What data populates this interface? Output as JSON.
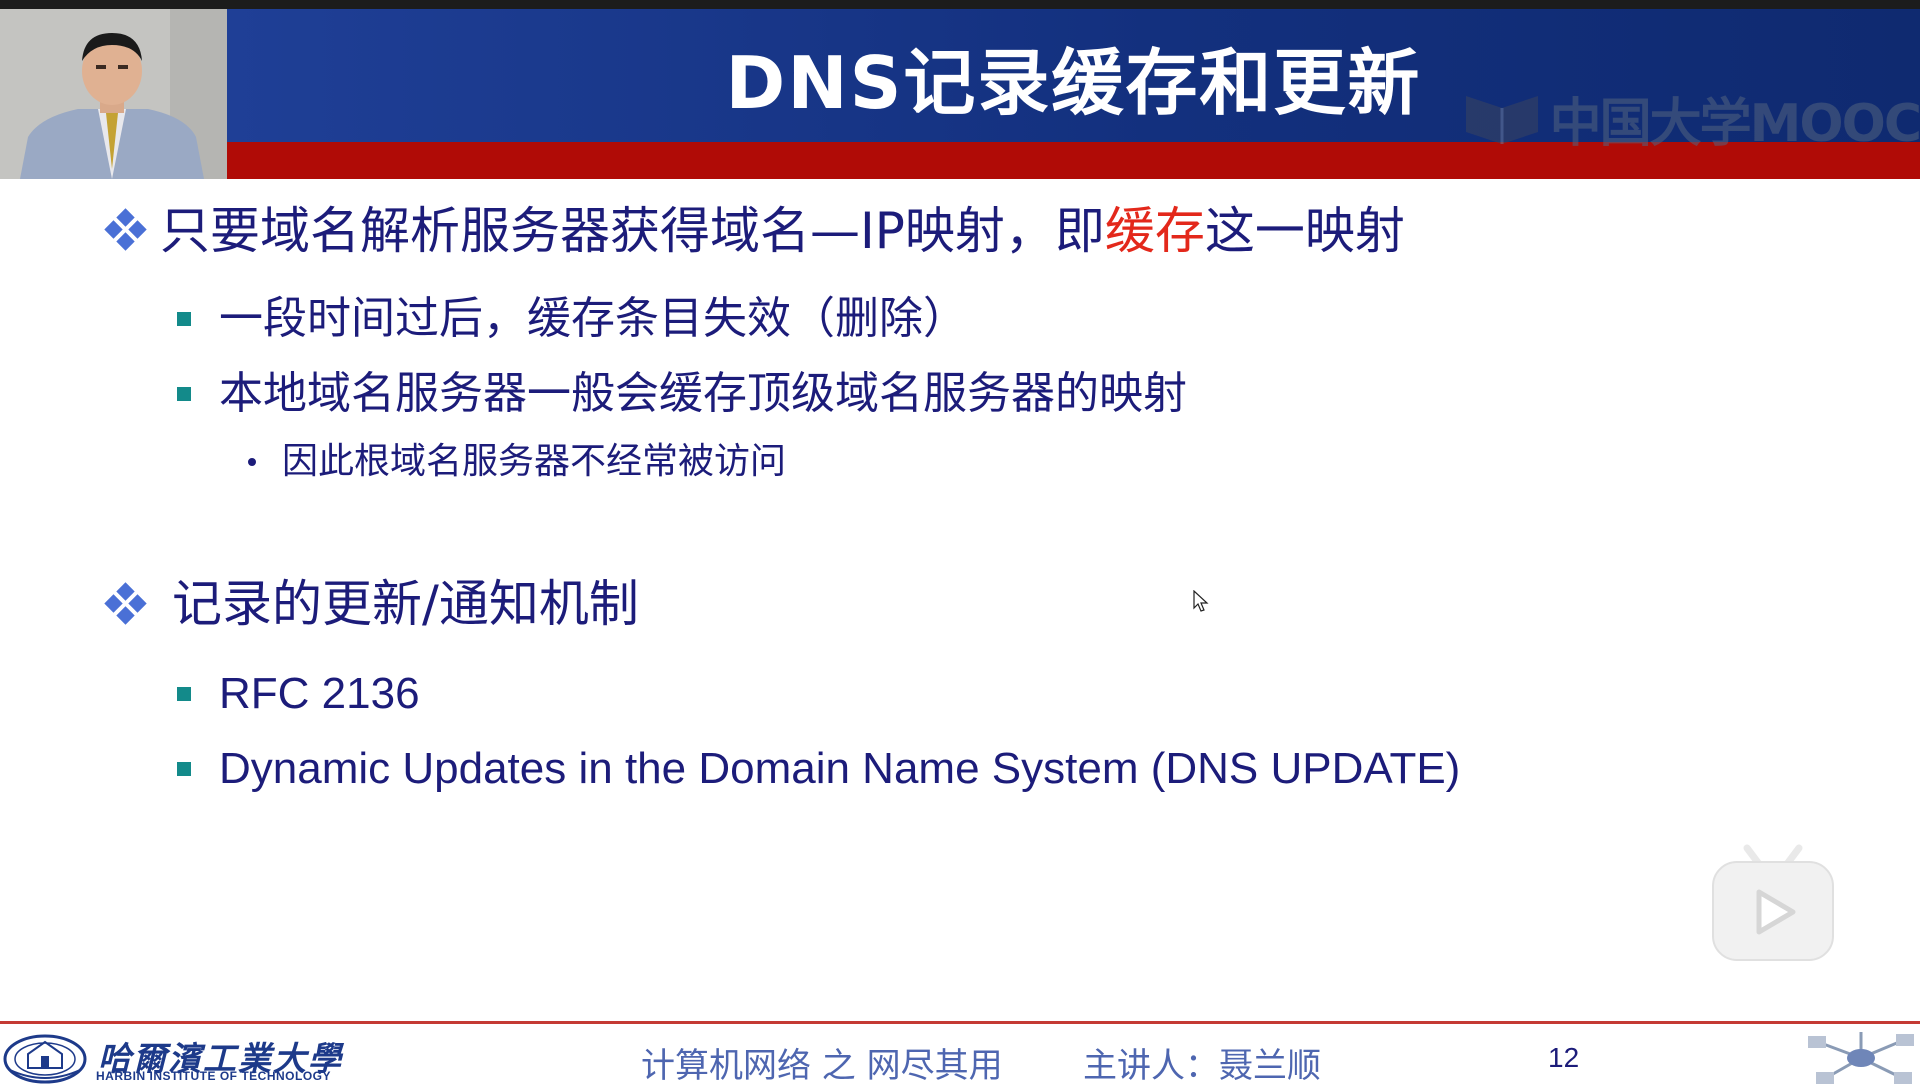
{
  "slide": {
    "title": "DNS记录缓存和更新",
    "watermark": "中国大学MOOC",
    "bullets": [
      {
        "text_before": "只要域名解析服务器获得域名—IP映射，即",
        "highlight": "缓存",
        "text_after": "这一映射",
        "subs": [
          {
            "text": "一段时间过后，缓存条目失效（删除）"
          },
          {
            "text": "本地域名服务器一般会缓存顶级域名服务器的映射",
            "subs": [
              {
                "text": "因此根域名服务器不经常被访问"
              }
            ]
          }
        ]
      },
      {
        "text": "记录的更新/通知机制",
        "subs": [
          {
            "text": "RFC 2136"
          },
          {
            "text": "Dynamic Updates in the Domain Name System (DNS UPDATE)"
          }
        ]
      }
    ]
  },
  "footer": {
    "university_cn": "哈爾濱工業大學",
    "university_en": "HARBIN INSTITUTE OF TECHNOLOGY",
    "course": "计算机网络 之 网尽其用",
    "lecturer": "主讲人：聂兰顺",
    "page_number": "12"
  },
  "colors": {
    "header_blue": "#13307e",
    "header_red": "#b00b06",
    "bullet_text": "#1c1c7a",
    "highlight": "#e3281b",
    "square_bullet": "#138a8a",
    "footer_text": "#4e66b0"
  },
  "icons": [
    "diamond-bullet-icon",
    "square-bullet-icon",
    "mouse-pointer-icon",
    "play-icon",
    "university-seal-icon",
    "network-icon",
    "mooc-logo-icon"
  ]
}
